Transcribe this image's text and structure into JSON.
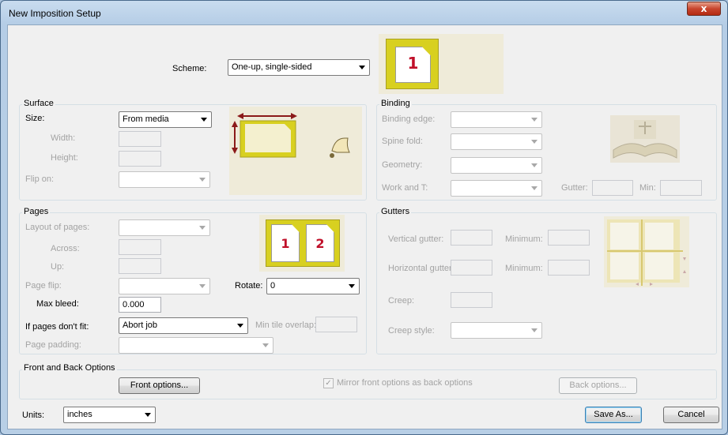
{
  "window": {
    "title": "New Imposition Setup",
    "close_glyph": "x"
  },
  "scheme": {
    "label": "Scheme:",
    "value": "One-up, single-sided",
    "preview_page": "1"
  },
  "surface": {
    "title": "Surface",
    "size_label": "Size:",
    "size_value": "From media",
    "width_label": "Width:",
    "height_label": "Height:",
    "flip_label": "Flip on:"
  },
  "binding": {
    "title": "Binding",
    "edge_label": "Binding edge:",
    "spine_label": "Spine fold:",
    "geometry_label": "Geometry:",
    "work_label": "Work and T:",
    "gutter_label": "Gutter:",
    "min_label": "Min:"
  },
  "pages": {
    "title": "Pages",
    "layout_label": "Layout of pages:",
    "across_label": "Across:",
    "up_label": "Up:",
    "flip_label": "Page flip:",
    "rotate_label": "Rotate:",
    "rotate_value": "0",
    "bleed_label": "Max bleed:",
    "bleed_value": "0.000",
    "fit_label": "If pages don't fit:",
    "fit_value": "Abort job",
    "tile_label": "Min tile overlap:",
    "padding_label": "Page padding:",
    "preview_pages": [
      "1",
      "2"
    ]
  },
  "gutters": {
    "title": "Gutters",
    "vertical_label": "Vertical gutter:",
    "vmin_label": "Minimum:",
    "horizontal_label": "Horizontal gutter:",
    "hmin_label": "Minimum:",
    "creep_label": "Creep:",
    "creep_style_label": "Creep style:"
  },
  "front_back": {
    "title": "Front and Back Options",
    "front_button": "Front options...",
    "mirror_label": "Mirror front options as back options",
    "mirror_checked": true,
    "back_button": "Back options..."
  },
  "footer": {
    "units_label": "Units:",
    "units_value": "inches",
    "save_button": "Save As...",
    "cancel_button": "Cancel"
  },
  "colors": {
    "preview_bg": "#efebd9",
    "page_frame": "#d8d020",
    "arrow": "#8b1a1a",
    "page_number": "#c0102a"
  }
}
